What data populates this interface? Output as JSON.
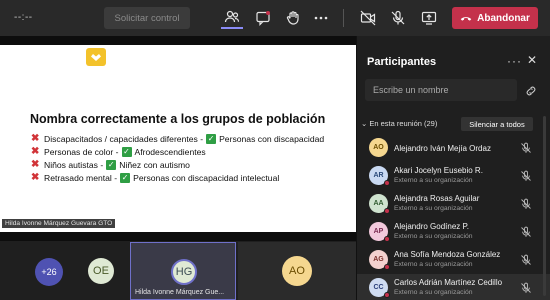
{
  "toolbar": {
    "timer": "--:--",
    "request_control": "Solicitar control",
    "leave": "Abandonar",
    "icons": [
      "people-icon",
      "chat-icon",
      "raise-hand-icon",
      "more-icon",
      "camera-off-icon",
      "mic-off-icon",
      "share-screen-icon",
      "phone-icon"
    ]
  },
  "slide": {
    "title": "Nombra correctamente a los grupos de población",
    "lines": [
      {
        "wrong": "Discapacitados / capacidades diferentes -",
        "right": "Personas con discapacidad"
      },
      {
        "wrong": "Personas de color -",
        "right": "Afrodescendientes"
      },
      {
        "wrong": "Niños autistas -",
        "right": "Niñez con autismo"
      },
      {
        "wrong": "Retrasado mental -",
        "right": "Personas con discapacidad intelectual"
      }
    ],
    "presenter": "Hilda Ivonne Márquez Guevara GTO"
  },
  "strip": {
    "more_count": "+26",
    "tiles": [
      {
        "initials": "OE",
        "name": "",
        "color": "#dfe9d4",
        "text_color": "#4a5a2a"
      },
      {
        "initials": "HG",
        "name": "Hilda Ivonne Márquez Gue...",
        "color": "#dfe9d4",
        "text_color": "#3d4d55"
      },
      {
        "initials": "AO",
        "name": "",
        "color": "#f5d78f",
        "text_color": "#6b4d00"
      }
    ]
  },
  "panel": {
    "title": "Participantes",
    "search_placeholder": "Escribe un nombre",
    "section_label": "En esta reunión (29)",
    "mute_all": "Silenciar a todos",
    "participants": [
      {
        "initials": "AO",
        "name": "Alejandro Iván Mejía Ordaz",
        "sub": "",
        "color": "#f5d78f",
        "text_color": "#6b4d00",
        "dot": false
      },
      {
        "initials": "AR",
        "name": "Akari Jocelyn Eusebio R.",
        "sub": "Externo a su organización",
        "color": "#c9d9f2",
        "text_color": "#2b4a7a",
        "dot": true
      },
      {
        "initials": "AA",
        "name": "Alejandra Rosas Aguilar",
        "sub": "Externo a su organización",
        "color": "#cfe3cf",
        "text_color": "#2f5a2f",
        "dot": true
      },
      {
        "initials": "AP",
        "name": "Alejandro Godínez P.",
        "sub": "Externo a su organización",
        "color": "#f2c9dc",
        "text_color": "#7a2b52",
        "dot": true
      },
      {
        "initials": "AG",
        "name": "Ana Sofía Mendoza González",
        "sub": "Externo a su organización",
        "color": "#f3d1cf",
        "text_color": "#7a2f2b",
        "dot": true
      },
      {
        "initials": "CC",
        "name": "Carlos Adrián Martínez Cedillo",
        "sub": "Externo a su organización",
        "color": "#cfdcf2",
        "text_color": "#2b3f7a",
        "dot": true
      }
    ]
  },
  "colors": {
    "accent": "#8b8cf7",
    "leave": "#c4314b",
    "check": "#2f9e44",
    "cross": "#d13438"
  }
}
